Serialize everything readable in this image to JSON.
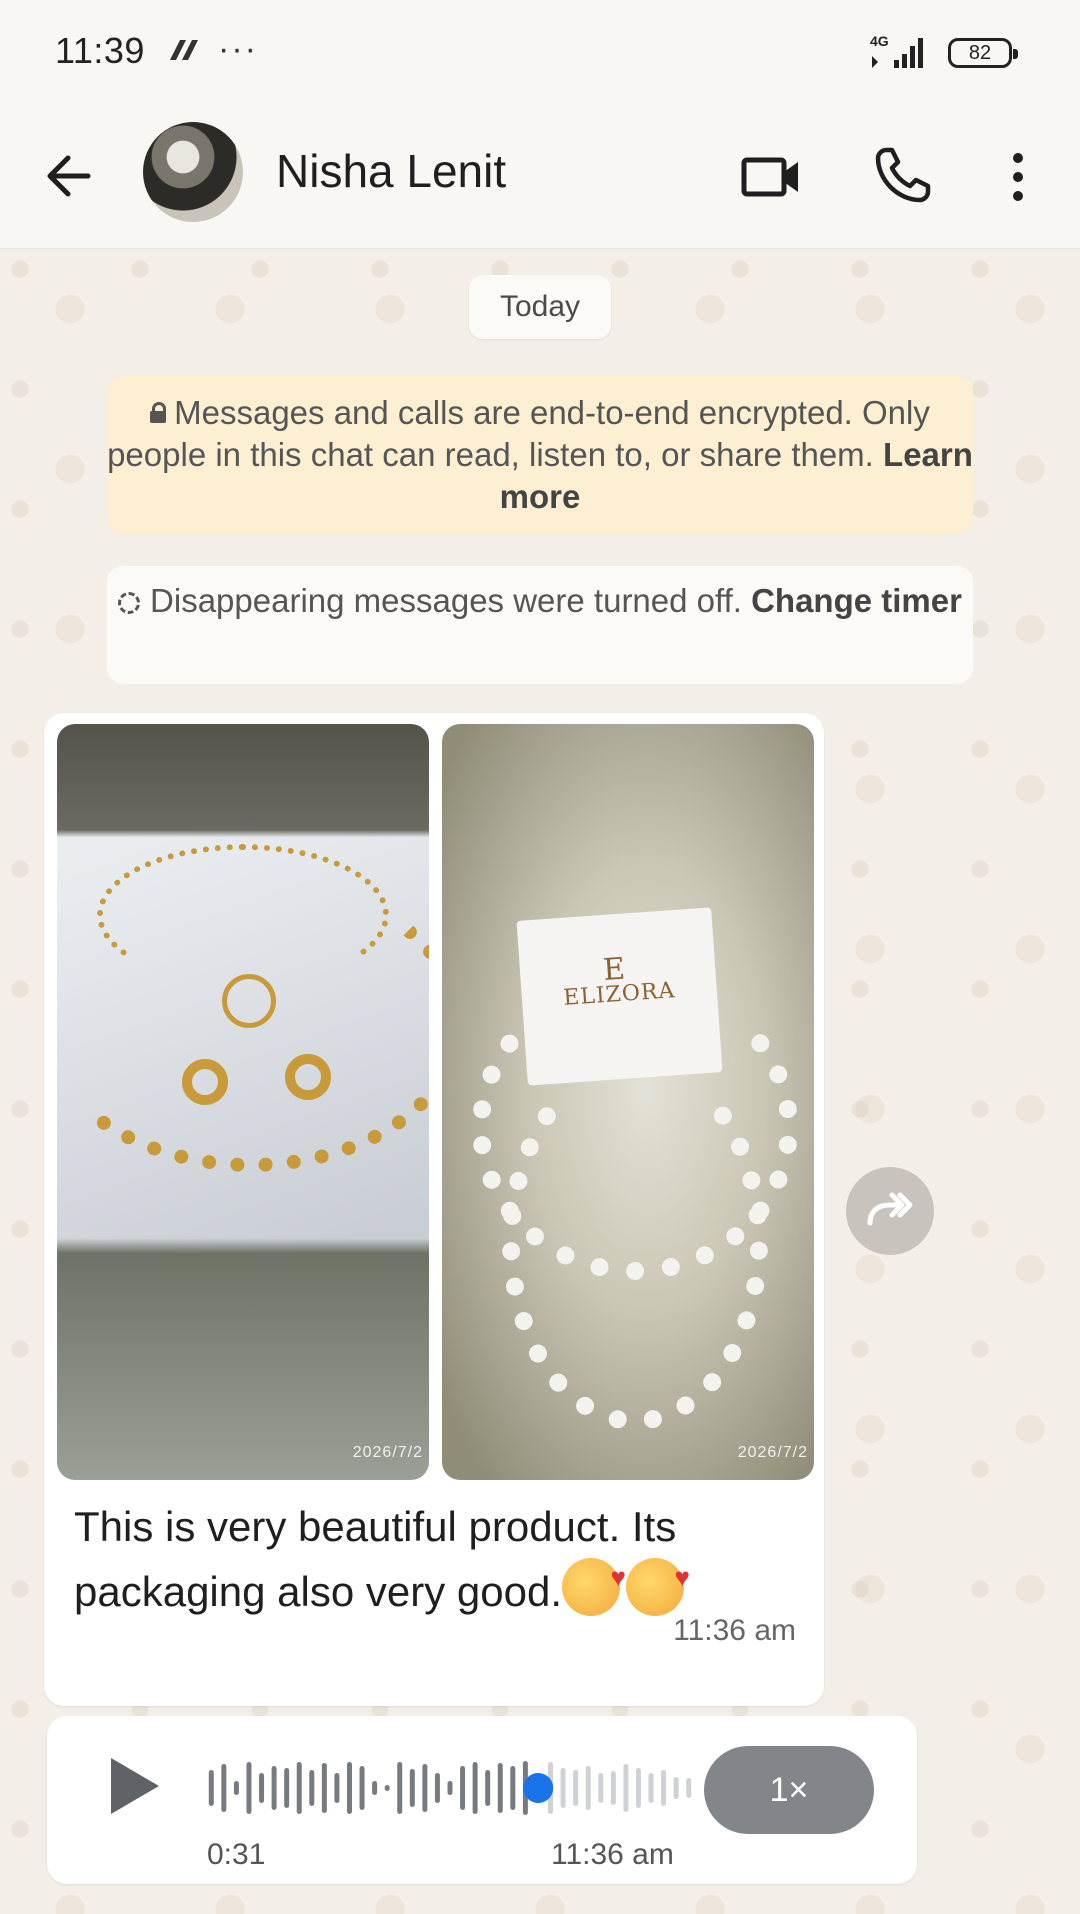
{
  "status_bar": {
    "time": "11:39",
    "dots": "···",
    "network": "4G",
    "battery": "82"
  },
  "header": {
    "contact_name": "Nisha Lenit"
  },
  "chat": {
    "date_chip": "Today",
    "encryption": {
      "text": "Messages and calls are end-to-end encrypted. Only people in this chat can read, listen to, or share them.",
      "link": "Learn more"
    },
    "disappearing": {
      "text": "Disappearing messages were turned off.",
      "link": "Change timer"
    },
    "image_message": {
      "photo1_date": "2026/7/2",
      "photo2_date": "2026/7/2",
      "photo2_brand": "ELIZORA",
      "photo2_mono": "E",
      "caption": "This is very beautiful product.  Its packaging also very good.",
      "time": "11:36 am"
    },
    "audio_message": {
      "duration": "0:31",
      "time": "11:36 am",
      "speed": "1×",
      "progress": 0.68
    }
  },
  "colors": {
    "chat_bg": "#f3efe8",
    "encryption_bg": "#fcefd2",
    "progress_dot": "#1a73e8",
    "speed_button": "#82868a"
  },
  "icons": [
    "back-arrow-icon",
    "video-call-icon",
    "phone-icon",
    "more-vert-icon",
    "lock-icon",
    "timer-icon",
    "forward-icon",
    "play-icon"
  ]
}
